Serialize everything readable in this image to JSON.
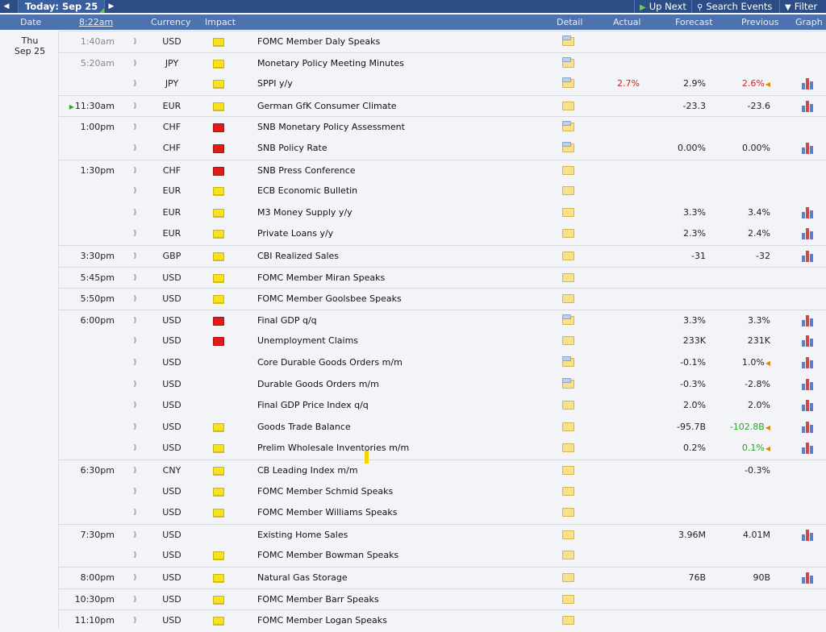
{
  "toolbar": {
    "title": "Today: Sep 25",
    "up_next": "Up Next",
    "search": "Search Events",
    "filter": "Filter"
  },
  "header": {
    "date": "Date",
    "time": "8:22am",
    "currency": "Currency",
    "impact": "Impact",
    "detail": "Detail",
    "actual": "Actual",
    "forecast": "Forecast",
    "previous": "Previous",
    "graph": "Graph"
  },
  "day": {
    "weekday": "Thu",
    "date": "Sep 25"
  },
  "colors": {
    "toolbar": "#2c4d85",
    "header": "#4e72ad",
    "impact_low": "#f6e21f",
    "impact_medium": "#f08a2a",
    "impact_high": "#e01919",
    "better": "#2aa32a",
    "worse": "#d42121"
  },
  "events": [
    {
      "time": "1:40am",
      "dim": true,
      "currency": "USD",
      "impact": "low",
      "title": "FOMC Member Daly Speaks",
      "detail": "updated",
      "actual": "",
      "forecast": "",
      "previous": "",
      "graph": false,
      "group_start": true
    },
    {
      "time": "5:20am",
      "dim": true,
      "currency": "JPY",
      "impact": "low",
      "title": "Monetary Policy Meeting Minutes",
      "detail": "updated",
      "actual": "",
      "forecast": "",
      "previous": "",
      "graph": false,
      "group_start": true
    },
    {
      "time": "",
      "currency": "JPY",
      "impact": "low",
      "title": "SPPI y/y",
      "detail": "updated",
      "actual": "2.7%",
      "actual_color": "red",
      "forecast": "2.9%",
      "previous": "2.6%",
      "previous_color": "red",
      "revised": true,
      "graph": true
    },
    {
      "time": "11:30am",
      "next": true,
      "currency": "EUR",
      "impact": "low",
      "title": "German GfK Consumer Climate",
      "detail": "folder",
      "actual": "",
      "forecast": "-23.3",
      "previous": "-23.6",
      "graph": true,
      "group_start": true
    },
    {
      "time": "1:00pm",
      "currency": "CHF",
      "impact": "high",
      "title": "SNB Monetary Policy Assessment",
      "detail": "updated",
      "actual": "",
      "forecast": "",
      "previous": "",
      "graph": false,
      "group_start": true
    },
    {
      "time": "",
      "currency": "CHF",
      "impact": "high",
      "title": "SNB Policy Rate",
      "detail": "updated",
      "actual": "",
      "forecast": "0.00%",
      "previous": "0.00%",
      "graph": true
    },
    {
      "time": "1:30pm",
      "currency": "CHF",
      "impact": "high",
      "title": "SNB Press Conference",
      "detail": "folder",
      "actual": "",
      "forecast": "",
      "previous": "",
      "graph": false,
      "group_start": true
    },
    {
      "time": "",
      "currency": "EUR",
      "impact": "low",
      "title": "ECB Economic Bulletin",
      "detail": "folder",
      "actual": "",
      "forecast": "",
      "previous": "",
      "graph": false
    },
    {
      "time": "",
      "currency": "EUR",
      "impact": "low",
      "title": "M3 Money Supply y/y",
      "detail": "folder",
      "actual": "",
      "forecast": "3.3%",
      "previous": "3.4%",
      "graph": true
    },
    {
      "time": "",
      "currency": "EUR",
      "impact": "low",
      "title": "Private Loans y/y",
      "detail": "folder",
      "actual": "",
      "forecast": "2.3%",
      "previous": "2.4%",
      "graph": true
    },
    {
      "time": "3:30pm",
      "currency": "GBP",
      "impact": "low",
      "title": "CBI Realized Sales",
      "detail": "folder",
      "actual": "",
      "forecast": "-31",
      "previous": "-32",
      "graph": true,
      "group_start": true
    },
    {
      "time": "5:45pm",
      "currency": "USD",
      "impact": "low",
      "title": "FOMC Member Miran Speaks",
      "detail": "folder",
      "actual": "",
      "forecast": "",
      "previous": "",
      "graph": false,
      "group_start": true
    },
    {
      "time": "5:50pm",
      "currency": "USD",
      "impact": "low",
      "title": "FOMC Member Goolsbee Speaks",
      "detail": "folder",
      "actual": "",
      "forecast": "",
      "previous": "",
      "graph": false,
      "group_start": true
    },
    {
      "time": "6:00pm",
      "currency": "USD",
      "impact": "high",
      "title": "Final GDP q/q",
      "detail": "updated",
      "actual": "",
      "forecast": "3.3%",
      "previous": "3.3%",
      "graph": true,
      "group_start": true
    },
    {
      "time": "",
      "currency": "USD",
      "impact": "high",
      "title": "Unemployment Claims",
      "detail": "folder",
      "actual": "",
      "forecast": "233K",
      "previous": "231K",
      "graph": true
    },
    {
      "time": "",
      "currency": "USD",
      "impact": "medium",
      "title": "Core Durable Goods Orders m/m",
      "detail": "updated",
      "actual": "",
      "forecast": "-0.1%",
      "previous": "1.0%",
      "revised": true,
      "graph": true
    },
    {
      "time": "",
      "currency": "USD",
      "impact": "medium",
      "title": "Durable Goods Orders m/m",
      "detail": "updated",
      "actual": "",
      "forecast": "-0.3%",
      "previous": "-2.8%",
      "graph": true
    },
    {
      "time": "",
      "currency": "USD",
      "impact": "medium",
      "title": "Final GDP Price Index q/q",
      "detail": "folder",
      "actual": "",
      "forecast": "2.0%",
      "previous": "2.0%",
      "graph": true
    },
    {
      "time": "",
      "currency": "USD",
      "impact": "low",
      "title": "Goods Trade Balance",
      "detail": "folder",
      "actual": "",
      "forecast": "-95.7B",
      "previous": "-102.8B",
      "previous_color": "green",
      "revised": true,
      "graph": true
    },
    {
      "time": "",
      "currency": "USD",
      "impact": "low",
      "title": "Prelim Wholesale Inventories m/m",
      "detail": "folder",
      "actual": "",
      "forecast": "0.2%",
      "previous": "0.1%",
      "previous_color": "green",
      "revised": true,
      "graph": true
    },
    {
      "time": "6:30pm",
      "currency": "CNY",
      "impact": "low",
      "title": "CB Leading Index m/m",
      "detail": "folder",
      "actual": "",
      "forecast": "",
      "previous": "-0.3%",
      "graph": false,
      "group_start": true
    },
    {
      "time": "",
      "currency": "USD",
      "impact": "low",
      "title": "FOMC Member Schmid Speaks",
      "detail": "folder",
      "actual": "",
      "forecast": "",
      "previous": "",
      "graph": false
    },
    {
      "time": "",
      "currency": "USD",
      "impact": "low",
      "title": "FOMC Member Williams Speaks",
      "detail": "folder",
      "actual": "",
      "forecast": "",
      "previous": "",
      "graph": false
    },
    {
      "time": "7:30pm",
      "currency": "USD",
      "impact": "medium",
      "title": "Existing Home Sales",
      "detail": "folder",
      "actual": "",
      "forecast": "3.96M",
      "previous": "4.01M",
      "graph": true,
      "group_start": true
    },
    {
      "time": "",
      "currency": "USD",
      "impact": "low",
      "title": "FOMC Member Bowman Speaks",
      "detail": "folder",
      "actual": "",
      "forecast": "",
      "previous": "",
      "graph": false
    },
    {
      "time": "8:00pm",
      "currency": "USD",
      "impact": "low",
      "title": "Natural Gas Storage",
      "detail": "folder",
      "actual": "",
      "forecast": "76B",
      "previous": "90B",
      "graph": true,
      "group_start": true
    },
    {
      "time": "10:30pm",
      "currency": "USD",
      "impact": "low",
      "title": "FOMC Member Barr Speaks",
      "detail": "folder",
      "actual": "",
      "forecast": "",
      "previous": "",
      "graph": false,
      "group_start": true
    },
    {
      "time": "11:10pm",
      "currency": "USD",
      "impact": "low",
      "title": "FOMC Member Logan Speaks",
      "detail": "folder",
      "actual": "",
      "forecast": "",
      "previous": "",
      "graph": false,
      "group_start": true
    }
  ]
}
